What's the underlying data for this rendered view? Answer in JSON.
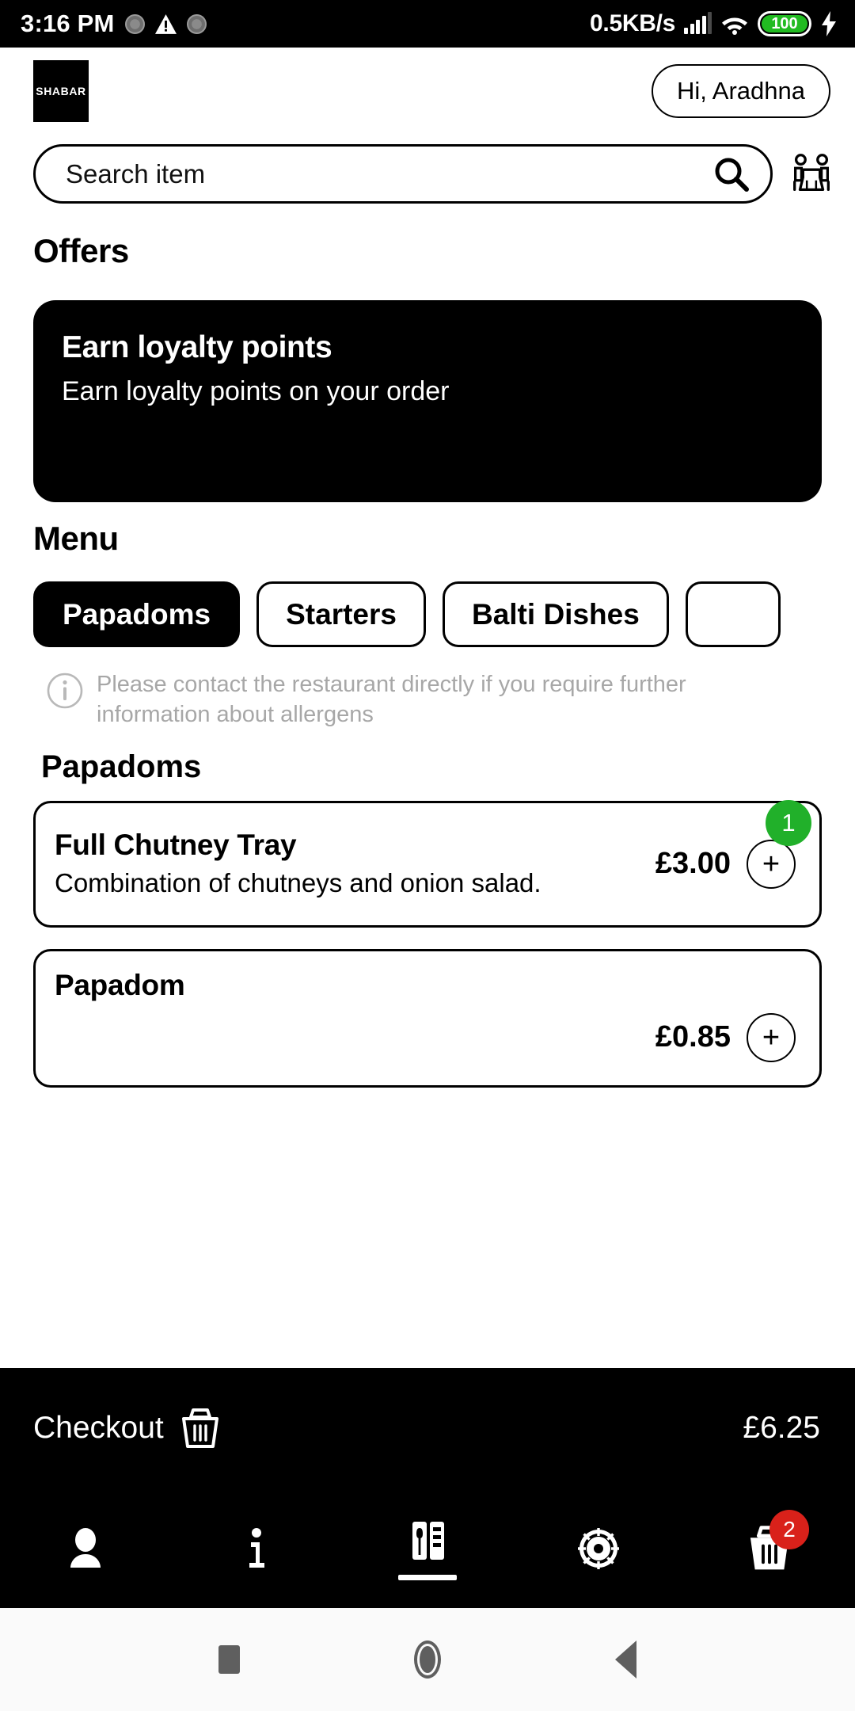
{
  "status_bar": {
    "time": "3:16 PM",
    "network_speed": "0.5KB/s",
    "battery_level": "100",
    "icons": [
      "loading-dot-icon",
      "warning-triangle-icon",
      "loading-dot-icon",
      "signal-bars-icon",
      "wifi-icon",
      "battery-icon",
      "charging-bolt-icon"
    ]
  },
  "header": {
    "logo_text": "SHABAR",
    "greeting": "Hi, Aradhna"
  },
  "search": {
    "placeholder": "Search item",
    "value": "",
    "search_icon": "search-icon",
    "book_table_icon": "table-booking-icon"
  },
  "offers": {
    "title": "Offers",
    "cards": [
      {
        "title": "Earn loyalty points",
        "subtitle": "Earn loyalty points on your order"
      }
    ]
  },
  "menu": {
    "title": "Menu",
    "tabs": [
      {
        "label": "Papadoms",
        "active": true
      },
      {
        "label": "Starters",
        "active": false
      },
      {
        "label": "Balti Dishes",
        "active": false
      },
      {
        "label": "",
        "active": false
      }
    ],
    "allergen_notice": "Please contact the restaurant directly if you require further information about allergens",
    "category_heading": "Papadoms",
    "items": [
      {
        "name": "Full Chutney Tray",
        "description": "Combination of chutneys and onion salad.",
        "price": "£3.00",
        "quantity": "1",
        "add_label": "+"
      },
      {
        "name": "Papadom",
        "description": "",
        "price": "£0.85",
        "quantity": "",
        "add_label": "+"
      }
    ]
  },
  "checkout": {
    "label": "Checkout",
    "total": "£6.25",
    "basket_icon": "basket-icon"
  },
  "bottom_nav": {
    "items": [
      {
        "name": "account",
        "icon": "person-icon",
        "active": false,
        "badge": ""
      },
      {
        "name": "info",
        "icon": "info-icon",
        "active": false,
        "badge": ""
      },
      {
        "name": "menu",
        "icon": "menu-cutlery-icon",
        "active": true,
        "badge": ""
      },
      {
        "name": "settings",
        "icon": "gear-icon",
        "active": false,
        "badge": ""
      },
      {
        "name": "basket",
        "icon": "basket-icon",
        "active": false,
        "badge": "2"
      }
    ]
  },
  "system_nav": {
    "recents": "recents-square-icon",
    "home": "home-circle-icon",
    "back": "back-triangle-icon"
  },
  "colors": {
    "brand_black": "#000000",
    "qty_badge_green": "#21b02a",
    "cart_badge_red": "#d9211a",
    "battery_green": "#21bb21",
    "muted_text": "#a7a7a7"
  }
}
